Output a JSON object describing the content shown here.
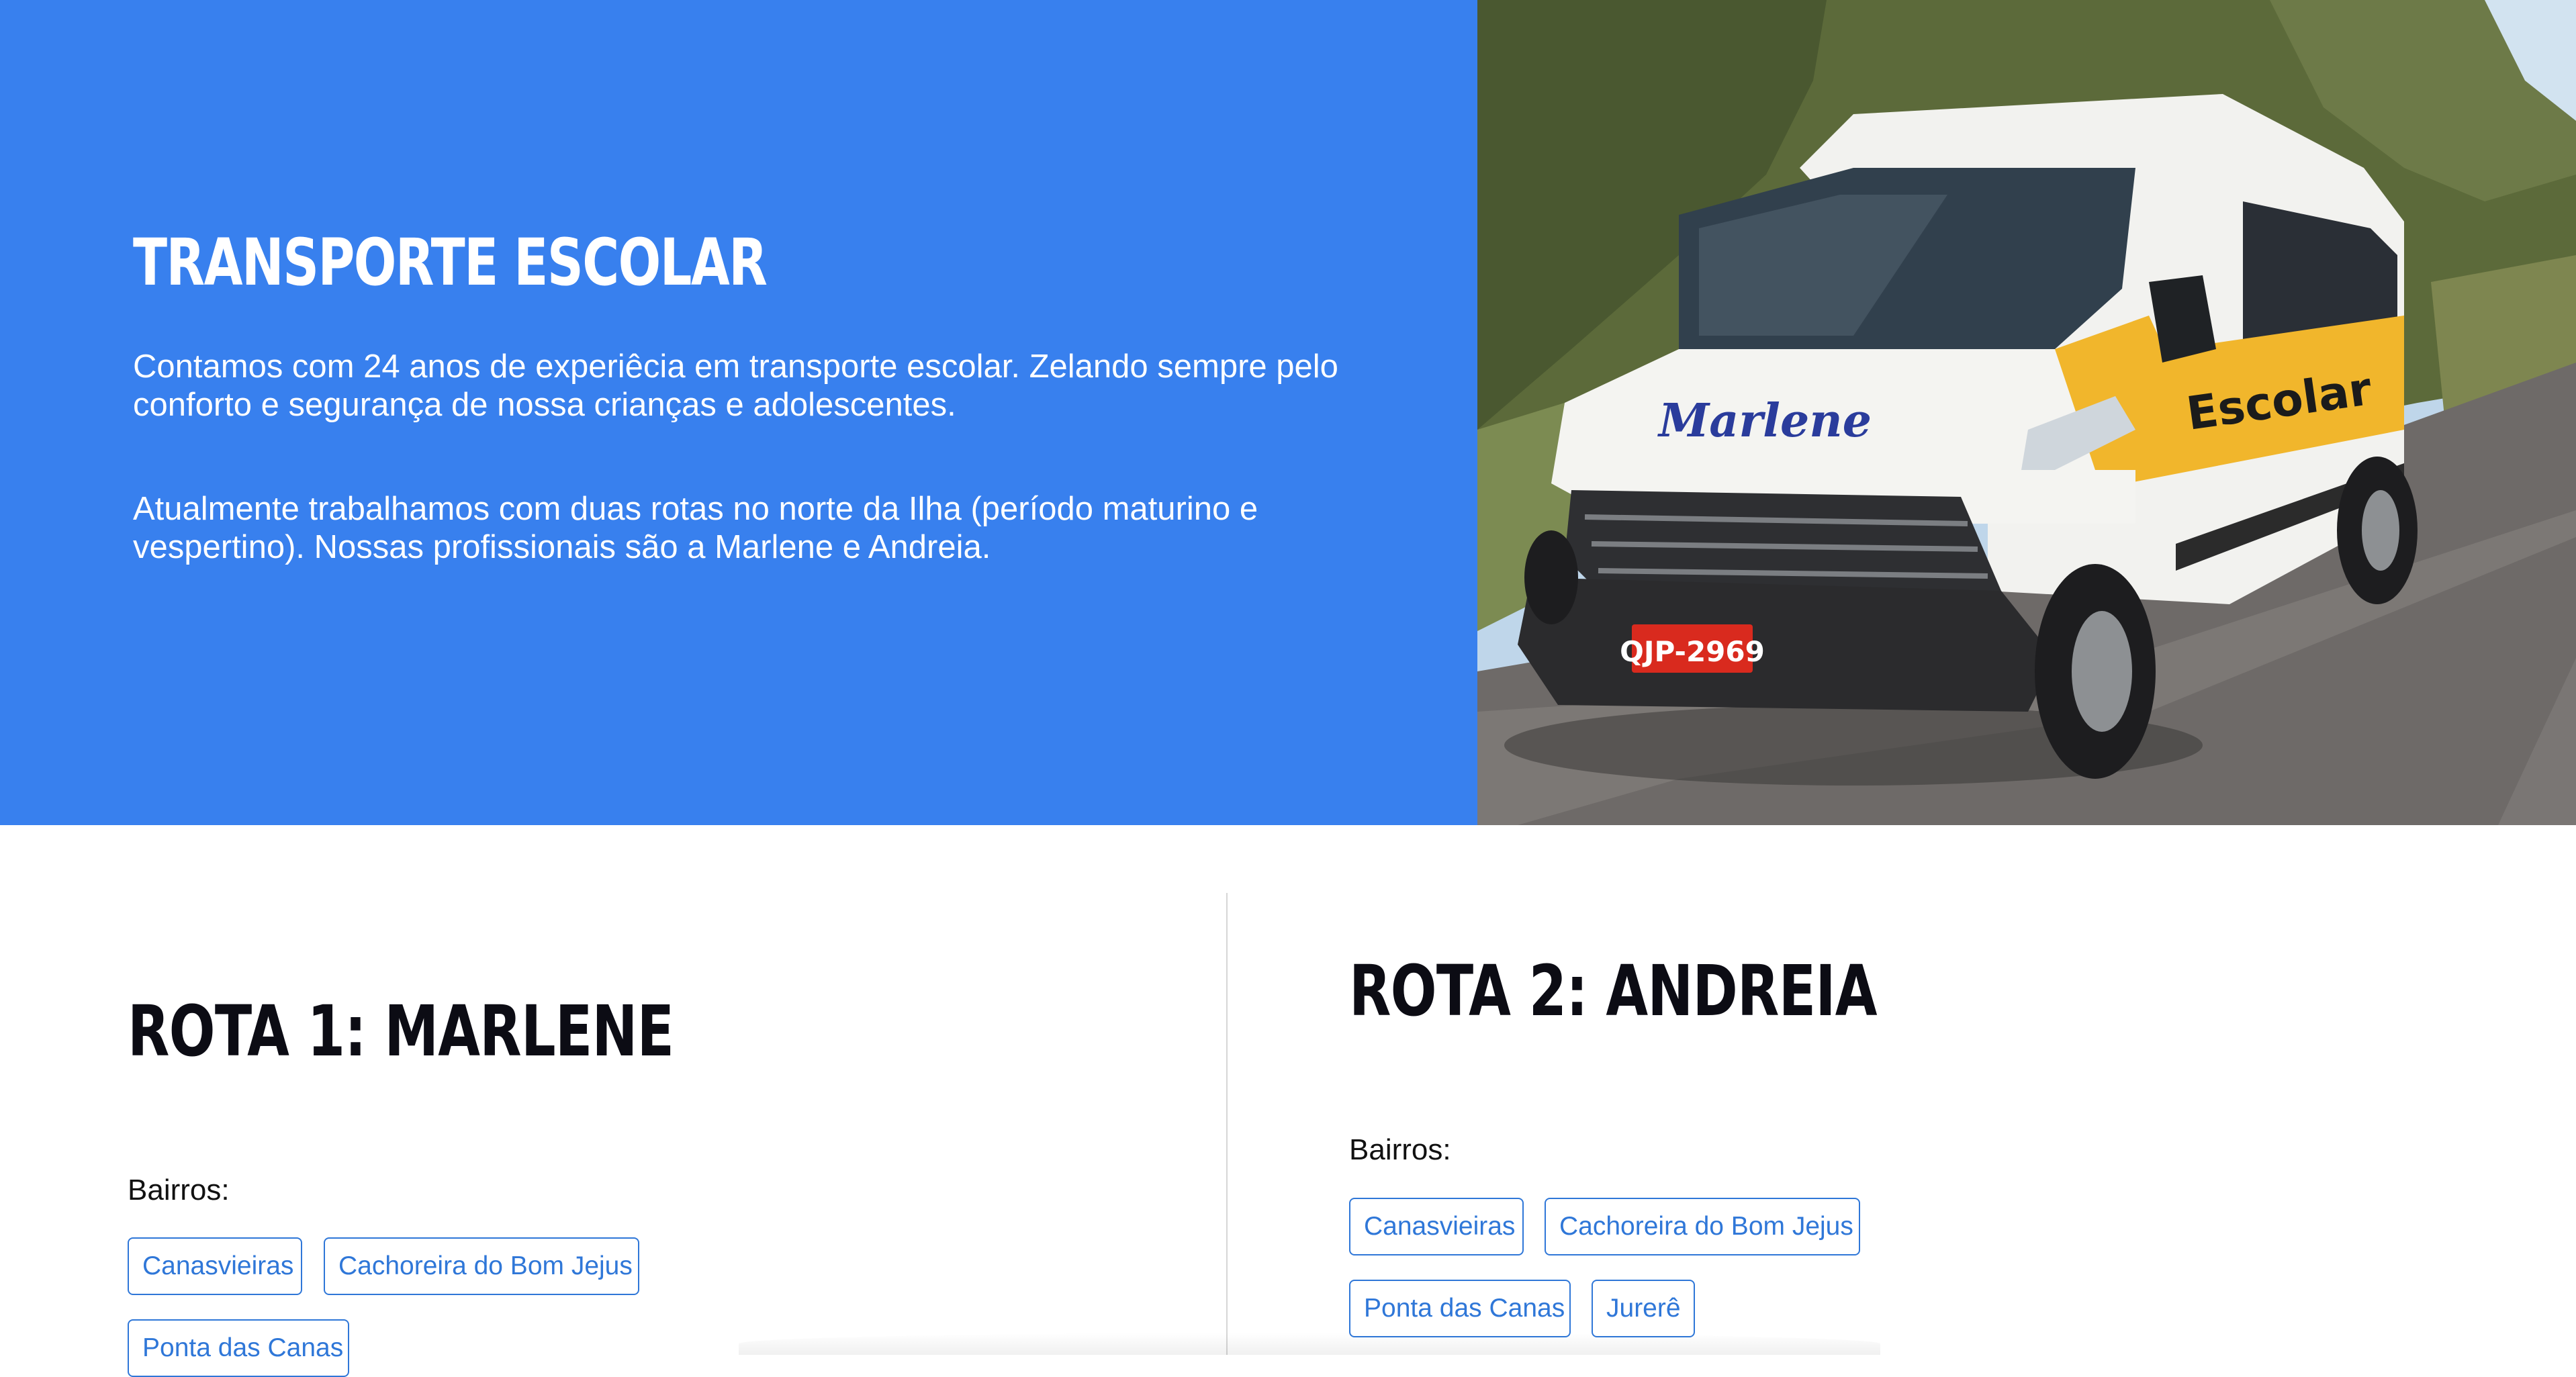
{
  "hero": {
    "title": "TRANSPORTE ESCOLAR",
    "paragraph_1": "Contamos com 24 anos de experiêcia em transporte escolar. Zelando sempre pelo conforto e segurança de nossa crianças e adolescentes.",
    "paragraph_2": "Atualmente trabalhamos com duas rotas no norte da Ilha (período maturino e vespertino). Nossas profissionais são a Marlene e Andreia.",
    "photo": {
      "van_name": "Marlene",
      "van_sign": "Escolar",
      "plate": "QJP-2969",
      "colors": {
        "sky": "#bfd6ea",
        "foliage": "#5c6a3a",
        "road": "#6e6a68",
        "van_white": "#f2f2ef",
        "van_yellow": "#f1b62c",
        "plate_red": "#d92a1e"
      }
    },
    "colors": {
      "background": "#3880ee",
      "text": "#ffffff"
    }
  },
  "routes": [
    {
      "title": "ROTA 1: MARLENE",
      "label": "Bairros:",
      "neighborhoods": [
        "Canasvieiras",
        "Cachoreira do Bom Jejus",
        "Ponta das Canas"
      ]
    },
    {
      "title": "ROTA 2: ANDREIA",
      "label": "Bairros:",
      "neighborhoods": [
        "Canasvieiras",
        "Cachoreira do Bom Jejus",
        "Ponta das Canas",
        "Jurerê"
      ]
    }
  ],
  "colors": {
    "chip_accent": "#2f77d8",
    "heading": "#0c0c14"
  }
}
